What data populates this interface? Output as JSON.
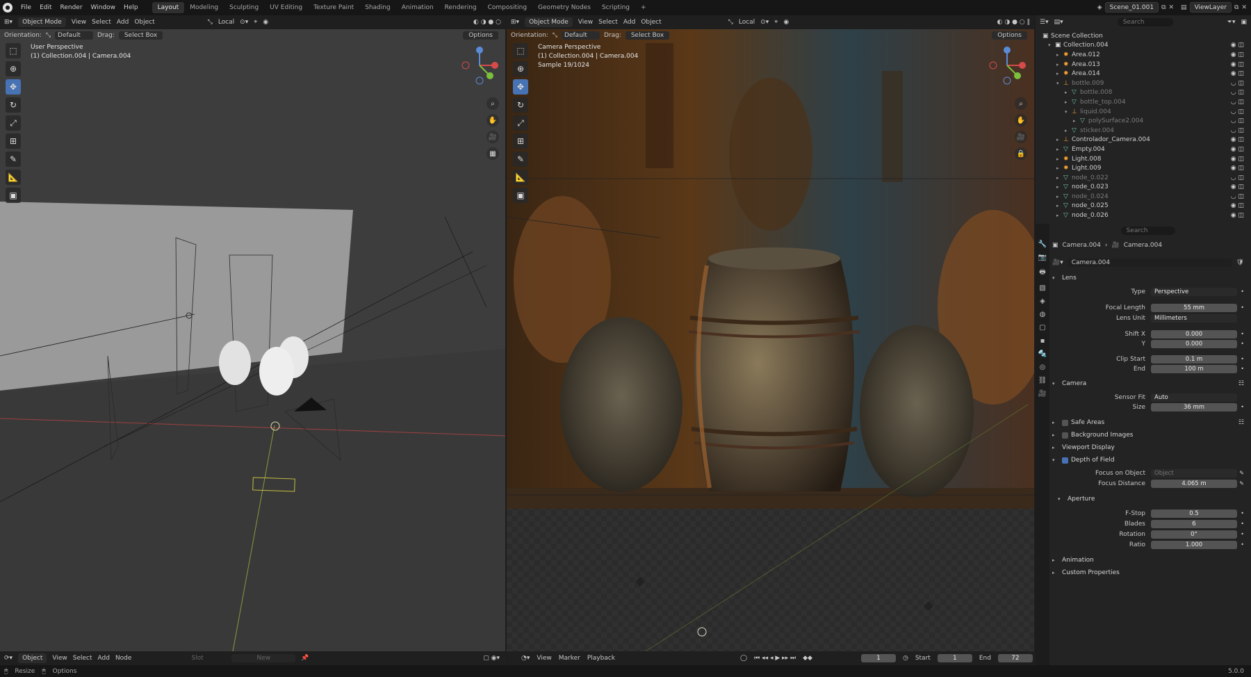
{
  "topbar": {
    "menus": [
      "File",
      "Edit",
      "Render",
      "Window",
      "Help"
    ],
    "workspaces": [
      "Layout",
      "Modeling",
      "Sculpting",
      "UV Editing",
      "Texture Paint",
      "Shading",
      "Animation",
      "Rendering",
      "Compositing",
      "Geometry Nodes",
      "Scripting"
    ],
    "active_workspace": "Layout",
    "add_tab": "+",
    "scene": "Scene_01.001",
    "view_layer": "ViewLayer"
  },
  "left_viewport": {
    "mode": "Object Mode",
    "menus": [
      "View",
      "Select",
      "Add",
      "Object"
    ],
    "transform_space": "Local",
    "orientation_label": "Orientation:",
    "orientation_value": "Default",
    "drag_label": "Drag:",
    "drag_value": "Select Box",
    "options": "Options",
    "info_line1": "User Perspective",
    "info_line2": "(1) Collection.004 | Camera.004"
  },
  "right_viewport": {
    "mode": "Object Mode",
    "menus": [
      "View",
      "Select",
      "Add",
      "Object"
    ],
    "transform_space": "Local",
    "orientation_label": "Orientation:",
    "orientation_value": "Default",
    "drag_label": "Drag:",
    "drag_value": "Select Box",
    "options": "Options",
    "info_line1": "Camera Perspective",
    "info_line2": "(1) Collection.004 | Camera.004",
    "info_line3": "Sample 19/1024"
  },
  "outliner": {
    "search_placeholder": "Search",
    "root": "Scene Collection",
    "rows": [
      {
        "label": "Collection.004",
        "dim": false,
        "kind": "collection"
      },
      {
        "label": "Area.012",
        "dim": false,
        "kind": "light"
      },
      {
        "label": "Area.013",
        "dim": false,
        "kind": "light"
      },
      {
        "label": "Area.014",
        "dim": false,
        "kind": "light"
      },
      {
        "label": "bottle.009",
        "dim": true,
        "kind": "empty"
      },
      {
        "label": "bottle.008",
        "dim": true,
        "kind": "mesh"
      },
      {
        "label": "bottle_top.004",
        "dim": true,
        "kind": "mesh"
      },
      {
        "label": "liquid.004",
        "dim": true,
        "kind": "empty"
      },
      {
        "label": "polySurface2.004",
        "dim": true,
        "kind": "mesh"
      },
      {
        "label": "sticker.004",
        "dim": true,
        "kind": "mesh"
      },
      {
        "label": "Controlador_Camera.004",
        "dim": false,
        "kind": "empty"
      },
      {
        "label": "Empty.004",
        "dim": false,
        "kind": "mesh"
      },
      {
        "label": "Light.008",
        "dim": false,
        "kind": "light"
      },
      {
        "label": "Light.009",
        "dim": false,
        "kind": "light"
      },
      {
        "label": "node_0.022",
        "dim": true,
        "kind": "mesh"
      },
      {
        "label": "node_0.023",
        "dim": false,
        "kind": "mesh"
      },
      {
        "label": "node_0.024",
        "dim": true,
        "kind": "mesh"
      },
      {
        "label": "node_0.025",
        "dim": false,
        "kind": "mesh"
      },
      {
        "label": "node_0.026",
        "dim": false,
        "kind": "mesh"
      }
    ]
  },
  "properties": {
    "search_placeholder": "Search",
    "breadcrumb_object": "Camera.004",
    "breadcrumb_data": "Camera.004",
    "data_name": "Camera.004",
    "lens": {
      "title": "Lens",
      "type_label": "Type",
      "type_value": "Perspective",
      "focal_label": "Focal Length",
      "focal_value": "55 mm",
      "unit_label": "Lens Unit",
      "unit_value": "Millimeters",
      "shiftx_label": "Shift X",
      "shiftx_value": "0.000",
      "shifty_label": "Y",
      "shifty_value": "0.000",
      "clipstart_label": "Clip Start",
      "clipstart_value": "0.1 m",
      "clipend_label": "End",
      "clipend_value": "100 m"
    },
    "camera": {
      "title": "Camera",
      "fit_label": "Sensor Fit",
      "fit_value": "Auto",
      "size_label": "Size",
      "size_value": "36 mm"
    },
    "safe_areas": "Safe Areas",
    "background_images": "Background Images",
    "viewport_display": "Viewport Display",
    "dof": {
      "title": "Depth of Field",
      "focus_obj_label": "Focus on Object",
      "focus_obj_placeholder": "Object",
      "focus_dist_label": "Focus Distance",
      "focus_dist_value": "4.065 m"
    },
    "aperture": {
      "title": "Aperture",
      "fstop_label": "F-Stop",
      "fstop_value": "0.5",
      "blades_label": "Blades",
      "blades_value": "6",
      "rotation_label": "Rotation",
      "rotation_value": "0°",
      "ratio_label": "Ratio",
      "ratio_value": "1.000"
    },
    "animation": "Animation",
    "custom_props": "Custom Properties"
  },
  "node_editor_header": {
    "mode": "Object",
    "menus": [
      "View",
      "Select",
      "Add",
      "Node"
    ],
    "slot": "Slot",
    "new_button": "New"
  },
  "timeline": {
    "menus": [
      "View",
      "Marker",
      "Playback"
    ],
    "current_frame": "1",
    "start_label": "Start",
    "start_value": "1",
    "end_label": "End",
    "end_value": "72"
  },
  "statusbar": {
    "left1": "Resize",
    "left2": "Options",
    "version": "5.0.0"
  }
}
